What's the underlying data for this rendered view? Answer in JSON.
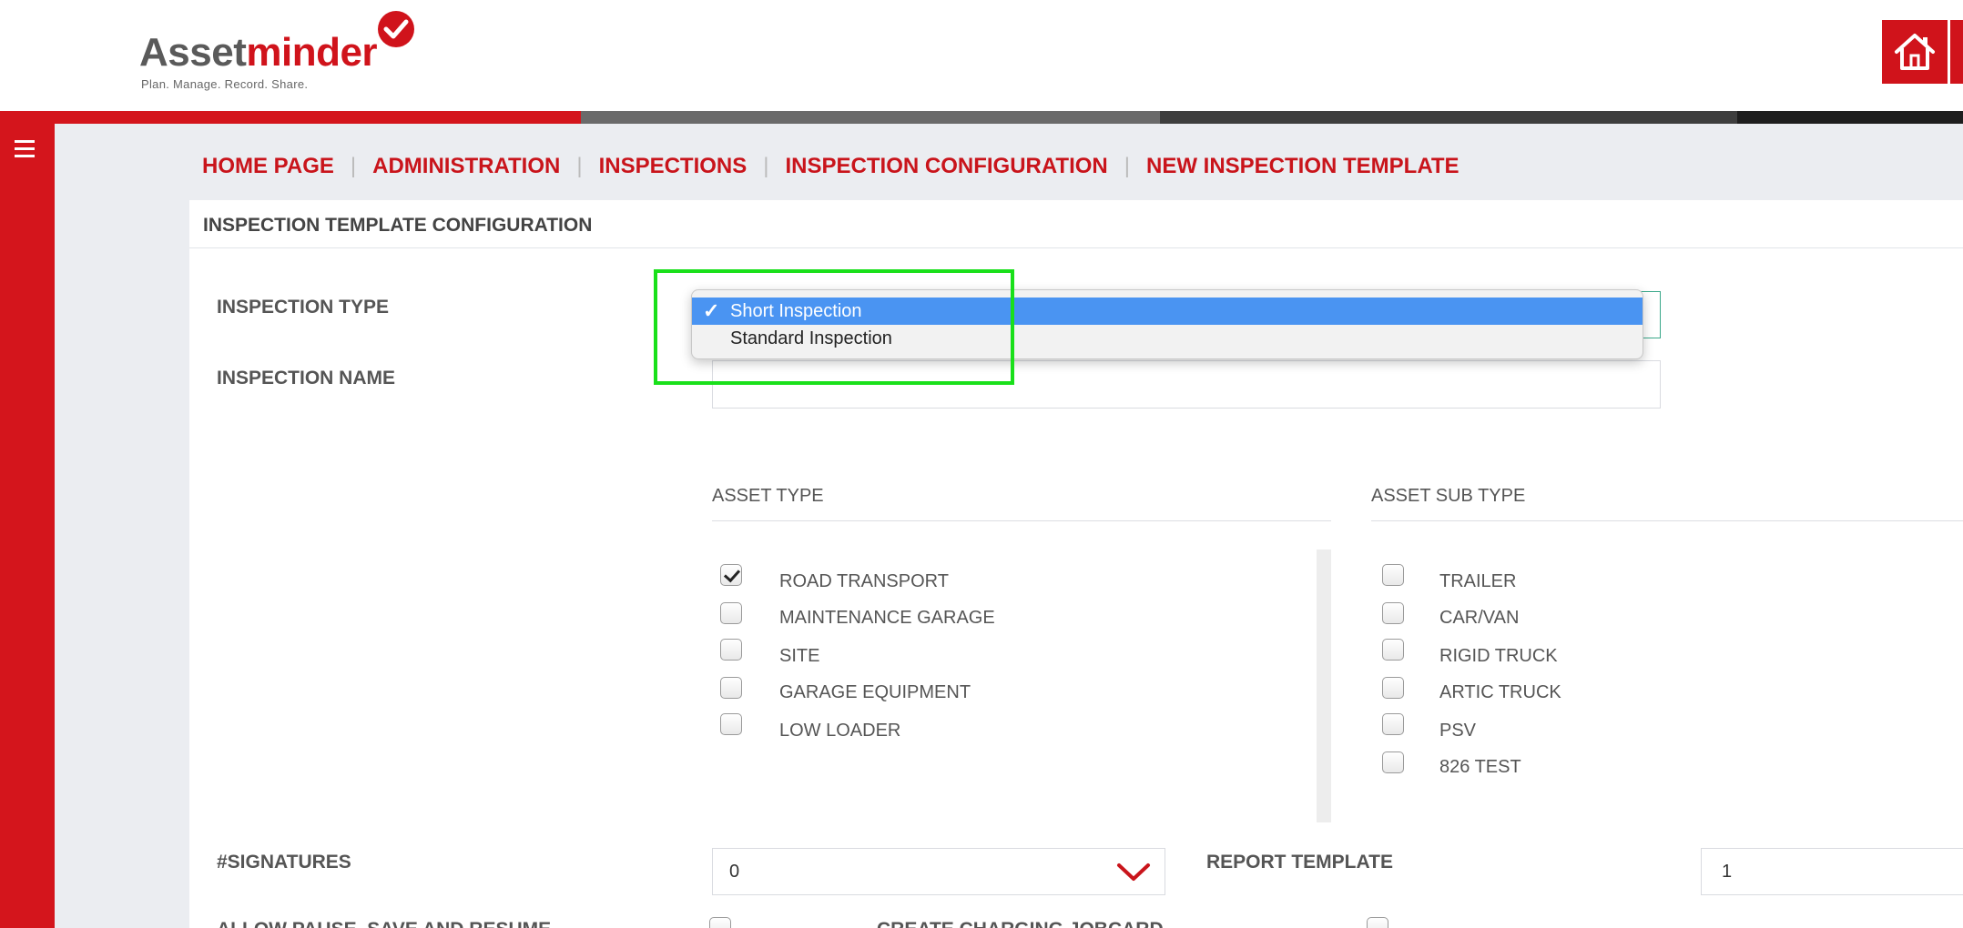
{
  "brand": {
    "name_part1": "Asset",
    "name_part2": "minder",
    "tagline": "Plan. Manage. Record. Share.",
    "primary_color": "#d0131b"
  },
  "header": {
    "home_icon": "home-icon"
  },
  "stripe_colors": [
    "#d4151c",
    "#6a6a6a",
    "#3e3e3e",
    "#1e1e1e"
  ],
  "sidebar": {
    "menu_icon": "hamburger-menu-icon"
  },
  "breadcrumb": {
    "items": [
      "HOME PAGE",
      "ADMINISTRATION",
      "INSPECTIONS",
      "INSPECTION CONFIGURATION",
      "NEW INSPECTION TEMPLATE"
    ],
    "separator": "|"
  },
  "card": {
    "title": "INSPECTION TEMPLATE CONFIGURATION"
  },
  "form": {
    "inspection_type_label": "INSPECTION TYPE",
    "inspection_name_label": "INSPECTION NAME",
    "inspection_name_value": "",
    "inspection_type_options": [
      {
        "label": "Short Inspection",
        "selected": true
      },
      {
        "label": "Standard Inspection",
        "selected": false
      }
    ],
    "asset_type_header": "ASSET TYPE",
    "asset_sub_type_header": "ASSET SUB TYPE",
    "asset_types": [
      {
        "label": "ROAD TRANSPORT",
        "checked": true
      },
      {
        "label": "MAINTENANCE GARAGE",
        "checked": false
      },
      {
        "label": "SITE",
        "checked": false
      },
      {
        "label": "GARAGE EQUIPMENT",
        "checked": false
      },
      {
        "label": "LOW LOADER",
        "checked": false
      }
    ],
    "asset_sub_types": [
      {
        "label": "TRAILER",
        "checked": false
      },
      {
        "label": "CAR/VAN",
        "checked": false
      },
      {
        "label": "RIGID TRUCK",
        "checked": false
      },
      {
        "label": "ARTIC TRUCK",
        "checked": false
      },
      {
        "label": "PSV",
        "checked": false
      },
      {
        "label": "826 TEST",
        "checked": false
      }
    ],
    "signatures_label": "#SIGNATURES",
    "signatures_value": "0",
    "report_template_label": "REPORT TEMPLATE",
    "report_template_value": "1",
    "allow_pause_label": "ALLOW PAUSE, SAVE AND RESUME",
    "create_jobcard_label": "CREATE CHARGING JOBCARD"
  }
}
